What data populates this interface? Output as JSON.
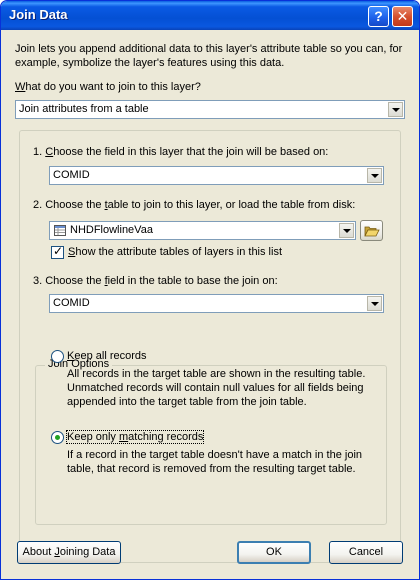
{
  "window": {
    "title": "Join Data",
    "help_symbol": "?",
    "close_symbol": "✕"
  },
  "intro": "Join lets you append additional data to this layer's attribute table so you can, for example, symbolize the layer's features using this data.",
  "join_type": {
    "label_accel": "W",
    "label_rest": "hat do you want to join to this layer?",
    "value": "Join attributes from a table"
  },
  "step1": {
    "pre": "1.  ",
    "accel": "C",
    "rest": "hoose the field in this layer that the join will be based on:",
    "value": "COMID"
  },
  "step2": {
    "pre": "2.  Choose the ",
    "accel": "t",
    "rest": "able to join to this layer, or load the table from disk:",
    "value": "NHDFlowlineVaa",
    "checkbox_accel": "S",
    "checkbox_rest": "how the attribute tables of layers in this list",
    "checkbox_checked": true
  },
  "step3": {
    "pre": "3.  Choose the ",
    "accel": "f",
    "rest": "ield in the table to base the join on:",
    "value": "COMID"
  },
  "join_options": {
    "title": "Join Options",
    "keep_all": {
      "accel": "K",
      "rest": "eep all records",
      "description": "All records in the target table are shown in the resulting table. Unmatched records will contain null values for all fields being appended into the target table from the join table."
    },
    "keep_matching": {
      "label_pre": "Keep only ",
      "accel": "m",
      "rest": "atching records",
      "description": "If a record in the target table doesn't have a match in the join table, that record is removed from the resulting target table."
    },
    "selected": "keep_matching"
  },
  "buttons": {
    "about_pre": "About ",
    "about_accel": "J",
    "about_rest": "oining Data",
    "ok": "OK",
    "cancel": "Cancel"
  },
  "icons": {
    "dropdown": "chevron-down-icon",
    "table": "table-icon",
    "folder": "open-folder-icon"
  }
}
